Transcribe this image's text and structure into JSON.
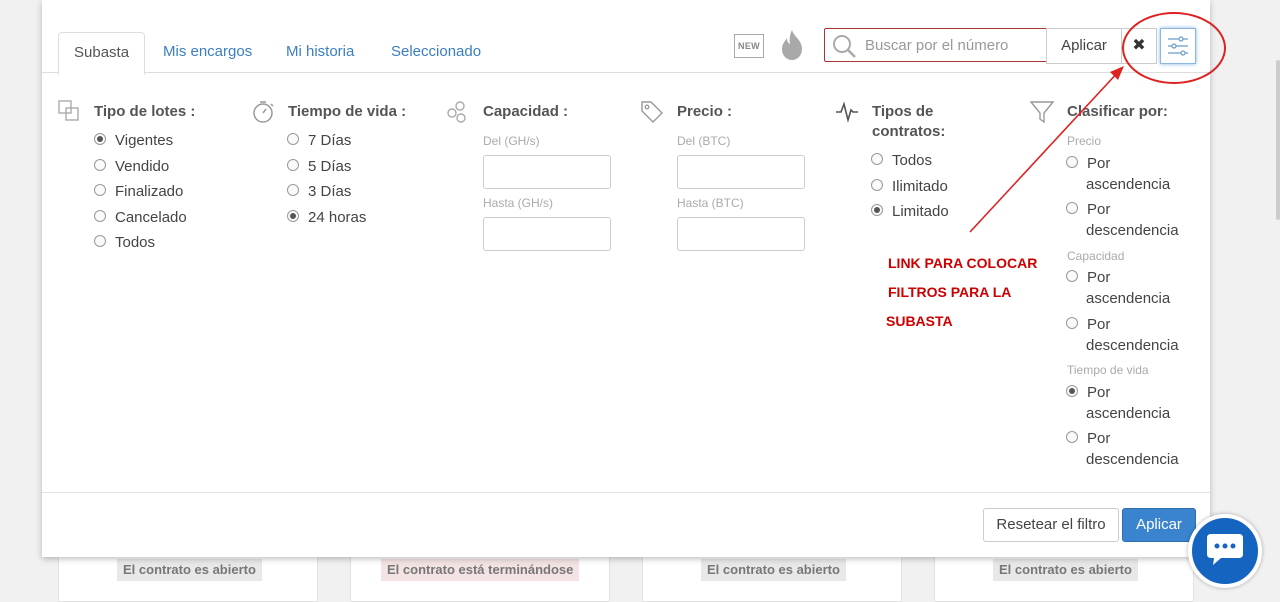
{
  "tabs": [
    "Subasta",
    "Mis encargos",
    "Mi historia",
    "Seleccionado"
  ],
  "header": {
    "new_icon_text": "NEW",
    "search_placeholder": "Buscar por el número",
    "search_apply": "Aplicar",
    "close_glyph": "✖"
  },
  "filters": {
    "lot_type": {
      "title": "Tipo de lotes :",
      "options": [
        "Vigentes",
        "Vendido",
        "Finalizado",
        "Cancelado",
        "Todos"
      ],
      "selected": 0
    },
    "lifetime": {
      "title": "Tiempo de vida :",
      "options": [
        "7 Días",
        "5 Días",
        "3 Días",
        "24 horas"
      ],
      "selected": 3
    },
    "capacity": {
      "title": "Capacidad :",
      "from_label": "Del (GH/s)",
      "to_label": "Hasta (GH/s)"
    },
    "price": {
      "title": "Precio :",
      "from_label": "Del (BTC)",
      "to_label": "Hasta (BTC)"
    },
    "contract_types": {
      "title_line1": "Tipos de",
      "title_line2": "contratos:",
      "options": [
        "Todos",
        "Ilimitado",
        "Limitado"
      ],
      "selected": 2
    },
    "sort": {
      "title": "Clasificar por:",
      "sections": [
        {
          "label": "Precio",
          "options": [
            [
              "Por",
              "ascendencia"
            ],
            [
              "Por",
              "descendencia"
            ]
          ],
          "selected": -1
        },
        {
          "label": "Capacidad",
          "options": [
            [
              "Por",
              "ascendencia"
            ],
            [
              "Por",
              "descendencia"
            ]
          ],
          "selected": -1
        },
        {
          "label": "Tiempo de vida",
          "options": [
            [
              "Por",
              "ascendencia"
            ],
            [
              "Por",
              "descendencia"
            ]
          ],
          "selected": 0
        }
      ]
    }
  },
  "annotation": {
    "lines": [
      "LINK PARA COLOCAR",
      "FILTROS PARA LA",
      "SUBASTA"
    ],
    "color": "#cc0000"
  },
  "footer": {
    "reset_label": "Resetear el filtro",
    "apply_label": "Aplicar"
  },
  "background_badges": [
    "El contrato es abierto",
    "El contrato está terminándose",
    "El contrato es abierto",
    "El contrato es abierto"
  ],
  "colors": {
    "accent": "#3a84cf",
    "link": "#3a7fc1",
    "chat": "#1565c0"
  }
}
